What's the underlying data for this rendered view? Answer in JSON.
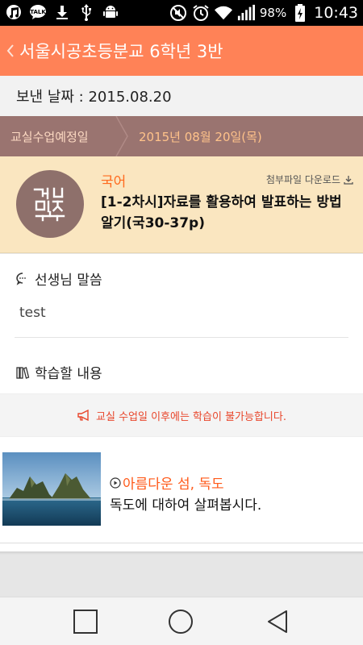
{
  "status_bar": {
    "notification_icons": [
      "music-app-icon",
      "talk-icon",
      "download-icon",
      "usb-icon",
      "android-icon"
    ],
    "talk_label": "TALK",
    "battery_percent": "98%",
    "time": "10:43"
  },
  "app_bar": {
    "title": "서울시공초등분교 6학년 3반"
  },
  "sent": {
    "label": "보낸 날짜 : 2015.08.20"
  },
  "schedule": {
    "label": "교실수업예정일",
    "date": "2015년 08월 20일(목)"
  },
  "subject_card": {
    "logo_text": "같이 배우",
    "subject": "국어",
    "download_label": "첨부파일 다운로드",
    "lesson": "[1-2차시]자료를 활용하여 발표하는 방법 알기(국30-37p)"
  },
  "teacher": {
    "heading": "선생님 말씀",
    "message": "test"
  },
  "study": {
    "heading": "학습할 내용",
    "notice": "교실 수업일 이후에는 학습이 불가능합니다.",
    "items": [
      {
        "title": "아름다운 섬, 독도",
        "description": "독도에 대하여 살펴봅시다."
      }
    ]
  },
  "colors": {
    "app_bar": "#ff8257",
    "schedule_bar": "#9a7470",
    "subject_card": "#fae6c0",
    "accent": "#ff5a1a"
  }
}
